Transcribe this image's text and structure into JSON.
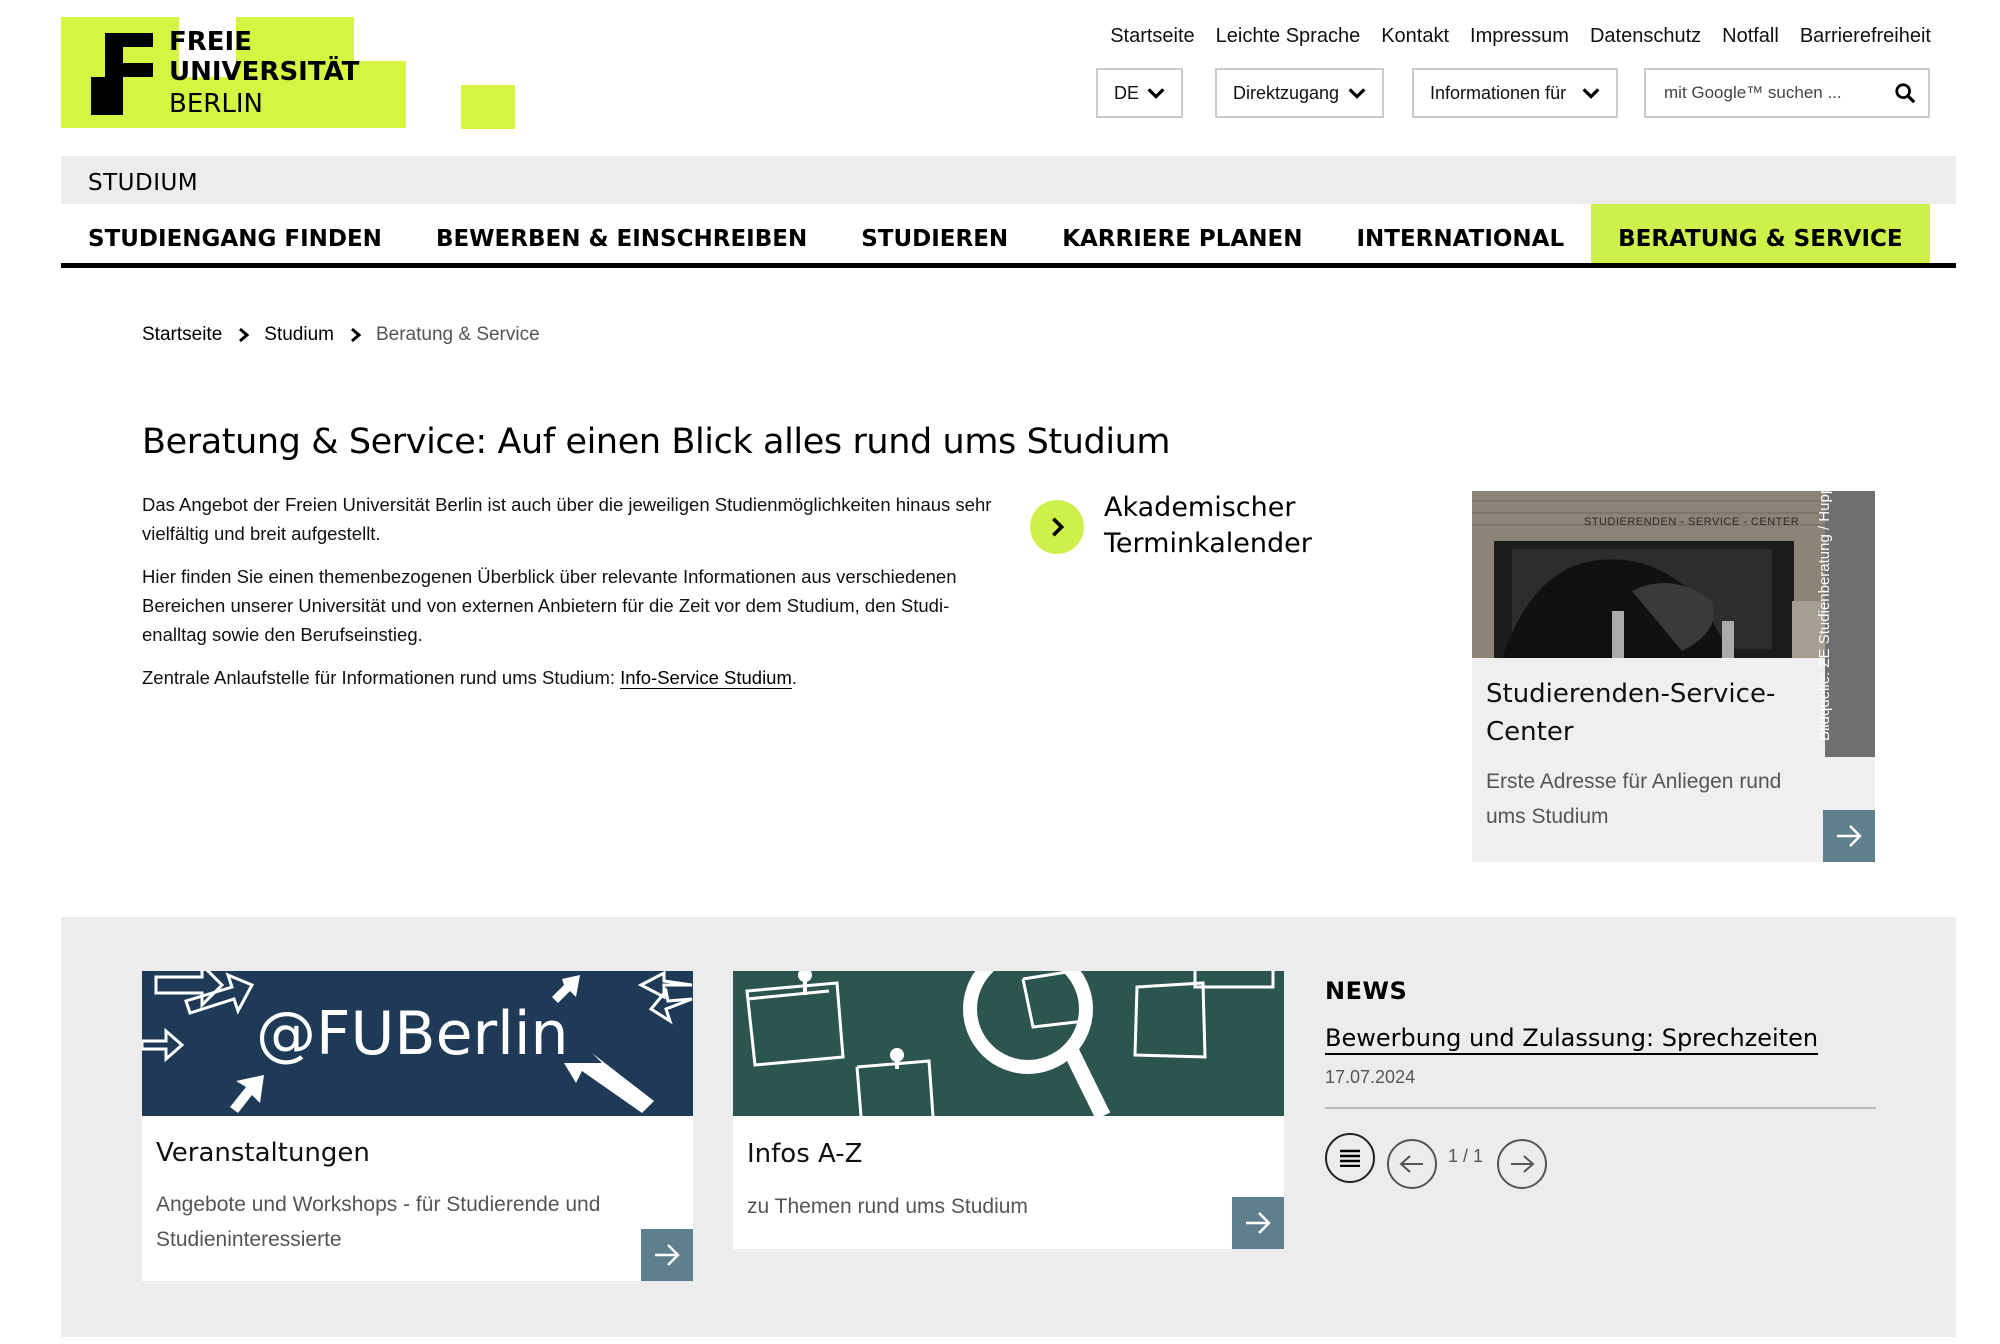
{
  "logo": {
    "line1": "FREIE",
    "line2": "UNIVERSITÄT",
    "line3": "BERLIN",
    "accent": "#d4f542"
  },
  "service_nav": [
    "Startseite",
    "Leichte Sprache",
    "Kontakt",
    "Impressum",
    "Datenschutz",
    "Notfall",
    "Barrierefreiheit"
  ],
  "toolbar": {
    "language": "DE",
    "direct_access": "Direktzugang",
    "info_for": "Informationen für",
    "search_placeholder": "mit Google™ suchen ..."
  },
  "section": {
    "title": "STUDIUM",
    "nav": [
      {
        "label": "STUDIENGANG FINDEN",
        "active": false
      },
      {
        "label": "BEWERBEN & EINSCHREIBEN",
        "active": false
      },
      {
        "label": "STUDIEREN",
        "active": false
      },
      {
        "label": "KARRIERE PLANEN",
        "active": false
      },
      {
        "label": "INTERNATIONAL",
        "active": false
      },
      {
        "label": "BERATUNG & SERVICE",
        "active": true
      }
    ]
  },
  "breadcrumb": {
    "items": [
      "Startseite",
      "Studium"
    ],
    "current": "Beratung & Service"
  },
  "main": {
    "title": "Beratung & Service: Auf einen Blick alles rund ums Studium",
    "para1": "Das Angebot der Freien Universität Berlin ist auch über die jeweiligen Studienmöglichkeiten hinaus sehr vielfältig und breit aufgestellt.",
    "para2": "Hier finden Sie einen themenbezogenen Überblick über relevante Informationen aus verschiedenen Bereichen unserer Universität und von externen Anbietern für die Zeit vor dem Studium, den Studi-enalltag sowie den Berufseinstieg.",
    "para3_prefix": "Zentrale Anlaufstelle für Informationen rund ums Studium: ",
    "para3_link": "Info-Service Studium",
    "para3_suffix": "."
  },
  "calendar_link": {
    "line1": "Akademischer",
    "line2": "Terminkalender"
  },
  "ssc_card": {
    "image_sign": "STUDIERENDEN - SERVICE - CENTER",
    "caption": "Bildquelle: ZE Studienberatung / Huppertz",
    "title_line1": "Studierenden-Service-",
    "title_line2": "Center",
    "sub_line1": "Erste Adresse für Anliegen rund",
    "sub_line2": "ums Studium"
  },
  "tiles": [
    {
      "image_text": "@FUBerlin",
      "title": "Veranstaltungen",
      "sub_line1": "Angebote und Workshops - für Studierende und",
      "sub_line2": "Studieninteressierte"
    },
    {
      "title": "Infos A-Z",
      "sub_line1": "zu Themen rund ums Studium"
    }
  ],
  "news": {
    "heading": "NEWS",
    "link": "Bewerbung und Zulassung: Sprechzeiten",
    "date": "17.07.2024",
    "pager": "1 / 1"
  }
}
